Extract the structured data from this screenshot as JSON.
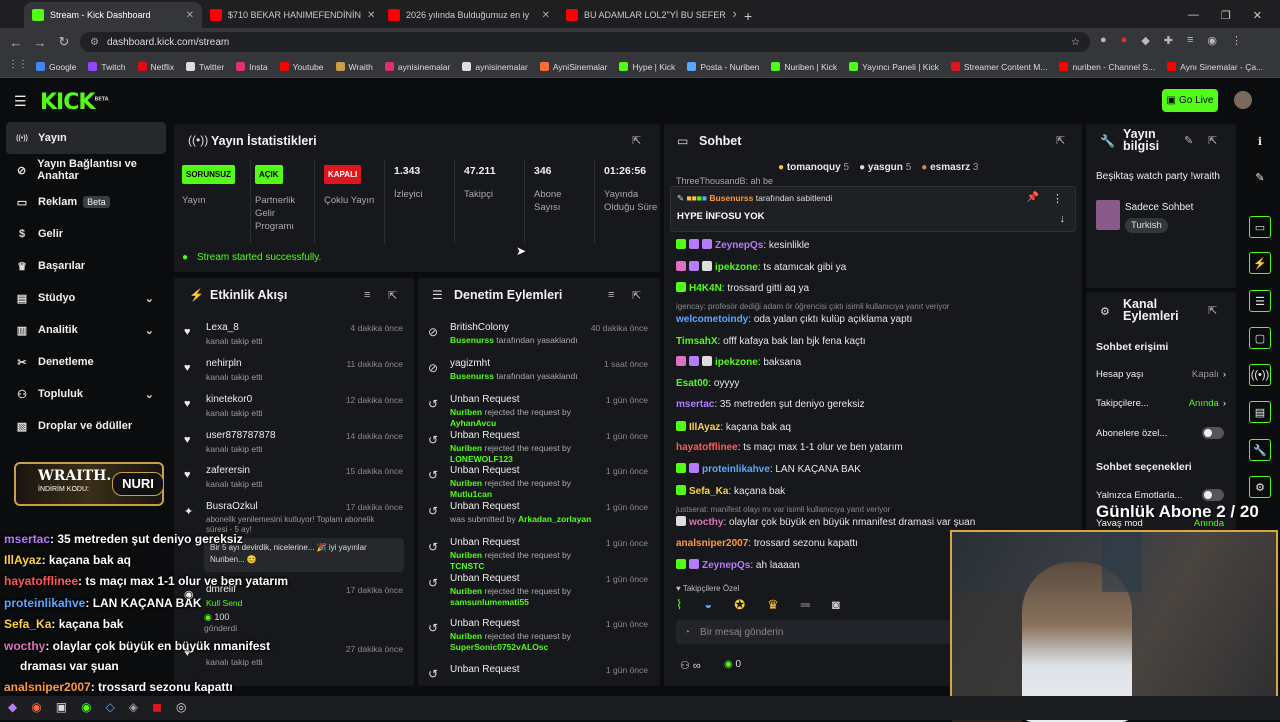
{
  "browser": {
    "tabs": [
      {
        "title": "Stream - Kick Dashboard",
        "color": "#53fc18"
      },
      {
        "title": "$710 BEKAR HANIMEFENDİNİN",
        "color": "#ff0000"
      },
      {
        "title": "2026 yılında Bulduğumuz en iy",
        "color": "#ff0000"
      },
      {
        "title": "BU ADAMLAR LOL2\"Yİ BU SEFER",
        "color": "#ff0000"
      }
    ],
    "url": "dashboard.kick.com/stream",
    "bookmarks": [
      "Google",
      "Twitch",
      "Netflix",
      "Twitter",
      "Insta",
      "Youtube",
      "Wraith",
      "aynisinemalar",
      "aynisinemalar",
      "AyniSinemalar",
      "Hype | Kick",
      "Posta - Nuriben",
      "Nuriben | Kick",
      "Yayıncı Paneli | Kick",
      "Streamer Content M...",
      "nuriben - Channel S...",
      "Aynı Sinemalar - Ça..."
    ]
  },
  "header": {
    "logo": "KICK",
    "beta": "BETA",
    "go_live": "Go Live"
  },
  "sidebar": {
    "items": [
      {
        "label": "Yayın",
        "icon": "broadcast-icon"
      },
      {
        "label": "Yayın Bağlantısı ve Anahtar",
        "icon": "link-icon"
      },
      {
        "label": "Reklam",
        "icon": "ad-icon",
        "badge": "Beta"
      },
      {
        "label": "Gelir",
        "icon": "money-icon"
      },
      {
        "label": "Başarılar",
        "icon": "trophy-icon"
      },
      {
        "label": "Stüdyo",
        "icon": "studio-icon"
      },
      {
        "label": "Analitik",
        "icon": "chart-icon"
      },
      {
        "label": "Denetleme",
        "icon": "moderation-icon"
      },
      {
        "label": "Topluluk",
        "icon": "community-icon"
      },
      {
        "label": "Droplar ve ödüller",
        "icon": "gift-icon"
      }
    ]
  },
  "stats": {
    "title": "Yayın İstatistikleri",
    "badges": [
      "SORUNSUZ",
      "AÇIK",
      "KAPALI"
    ],
    "labels": [
      "Yayın",
      "Partnerlik Gelir Programı",
      "Çoklu Yayın"
    ],
    "viewers": {
      "value": "1.343",
      "label": "İzleyici"
    },
    "followers": {
      "value": "47.211",
      "label": "Takipçi"
    },
    "subs": {
      "value": "346",
      "label": "Abone Sayısı"
    },
    "uptime": {
      "value": "01:26:56",
      "label": "Yayında Olduğu Süre"
    },
    "success": "Stream started successfully."
  },
  "activity": {
    "title": "Etkinlik Akışı",
    "items": [
      {
        "name": "Lexa_8",
        "sub": "kanalı takip etti",
        "time": "4 dakika önce"
      },
      {
        "name": "nehirpln",
        "sub": "kanalı takip etti",
        "time": "11 dakika önce"
      },
      {
        "name": "kinetekor0",
        "sub": "kanalı takip etti",
        "time": "12 dakika önce"
      },
      {
        "name": "user878787878",
        "sub": "kanalı takip etti",
        "time": "14 dakika önce"
      },
      {
        "name": "zaferersin",
        "sub": "kanalı takip etti",
        "time": "15 dakika önce"
      },
      {
        "name": "BusraOzkul",
        "sub": "abonelik yenilemesini kutluyor! Toplam abonelik süresi - 5 ay!",
        "time": "17 dakika önce"
      },
      {
        "name": "dmrelif",
        "sub": "Kull Send",
        "time": "17 dakika önce"
      },
      {
        "name": "",
        "sub": "kanalı takip etti",
        "time": "27 dakika önce"
      }
    ],
    "sub_msg": "Bir 5 ayı devirdik, nicelerine... 🎉 iyi yayınlar Nuriben... 😊",
    "kicks": "100",
    "kicks_label": "gönderdi"
  },
  "moderation": {
    "title": "Denetim Eylemleri",
    "items": [
      {
        "name": "BritishColony",
        "actor": "Busenurss",
        "rest": " tarafından yasaklandı",
        "time": "40 dakika önce",
        "type": "ban"
      },
      {
        "name": "yagizmht",
        "actor": "Busenurss",
        "rest": " tarafından yasaklandı",
        "time": "1 saat önce",
        "type": "ban"
      },
      {
        "name": "Unban Request",
        "actor": "Nuriben",
        "rest": " rejected the request by ",
        "target": "AyhanAvcu",
        "time": "1 gün önce",
        "type": "unban"
      },
      {
        "name": "Unban Request",
        "actor": "Nuriben",
        "rest": " rejected the request by ",
        "target": "LONEWOLF123",
        "time": "1 gün önce",
        "type": "unban"
      },
      {
        "name": "Unban Request",
        "actor": "Nuriben",
        "rest": " rejected the request by ",
        "target": "Mutlu1can",
        "time": "1 gün önce",
        "type": "unban"
      },
      {
        "name": "Unban Request",
        "actor": "",
        "rest": "was submitted by ",
        "target": "Arkadan_zorlayan",
        "time": "1 gün önce",
        "type": "unban"
      },
      {
        "name": "Unban Request",
        "actor": "Nuriben",
        "rest": " rejected the request by ",
        "target": "TCNSTC",
        "time": "1 gün önce",
        "type": "unban"
      },
      {
        "name": "Unban Request",
        "actor": "Nuriben",
        "rest": " rejected the request by ",
        "target": "samsunlumemati55",
        "time": "1 gün önce",
        "type": "unban"
      },
      {
        "name": "Unban Request",
        "actor": "Nuriben",
        "rest": " rejected the request by ",
        "target": "SuperSonic0752vALOsc",
        "time": "1 gün önce",
        "type": "unban"
      },
      {
        "name": "Unban Request",
        "actor": "",
        "rest": "",
        "target": "",
        "time": "1 gün önce",
        "type": "unban"
      }
    ]
  },
  "chat": {
    "title": "Sohbet",
    "top": [
      {
        "name": "tomanoquy",
        "n": "5"
      },
      {
        "name": "yasgun",
        "n": "5"
      },
      {
        "name": "esmasrz",
        "n": "3"
      }
    ],
    "pinned_by": "Busenurss",
    "pinned_by_text": "tarafından sabitlendi",
    "pinned_msg": "HYPE İNFOSU YOK",
    "cut_name": "ThreeThousandB: ah be",
    "lines": [
      {
        "user": "ZeynepQs",
        "color": "#b57cff",
        "msg": "kesinlikle",
        "badges": [
          "#53fc18",
          "#b57cff",
          "#b57cff"
        ]
      },
      {
        "user": "ipekzone",
        "color": "#53fc18",
        "msg": "ts atamıcak gibi ya",
        "badges": [
          "#e070c0",
          "#b57cff",
          "#ddd"
        ]
      },
      {
        "user": "H4K4N",
        "color": "#53fc18",
        "msg": "trossard gitti aq ya",
        "badges": [
          "#53fc18"
        ]
      },
      {
        "user": "welcometoindy",
        "color": "#5aa8ff",
        "msg": "oda yalan çıktı kulüp açıklama yaptı",
        "badges": []
      },
      {
        "user": "TimsahX",
        "color": "#53fc18",
        "msg": "offf kafaya bak lan bjk fena kaçtı",
        "badges": []
      },
      {
        "user": "ipekzone",
        "color": "#53fc18",
        "msg": "baksana",
        "badges": [
          "#e070c0",
          "#b57cff",
          "#ddd"
        ]
      },
      {
        "user": "Esat00",
        "color": "#53fc18",
        "msg": "oyyyy",
        "badges": []
      },
      {
        "user": "msertac",
        "color": "#b57cff",
        "msg": "35 metreden şut deniyo gereksiz",
        "badges": []
      },
      {
        "user": "IllAyaz",
        "color": "#ffd23f",
        "msg": "kaçana bak aq",
        "badges": [
          "#53fc18"
        ]
      },
      {
        "user": "hayatofflinee",
        "color": "#ff5a5a",
        "msg": "ts maçı max 1-1 olur ve ben yatarım",
        "badges": []
      },
      {
        "user": "proteinlikahve",
        "color": "#5aa8ff",
        "msg": "LAN KAÇANA BAK",
        "badges": [
          "#53fc18",
          "#b57cff"
        ]
      },
      {
        "user": "Sefa_Ka",
        "color": "#ffd23f",
        "msg": "kaçana bak",
        "badges": [
          "#53fc18"
        ]
      },
      {
        "user": "wocthy",
        "color": "#e070c0",
        "msg": "olaylar çok büyük en büyük nmanifest dramasi var şuan",
        "badges": [
          "#ddd"
        ]
      },
      {
        "user": "analsniper2007",
        "color": "#ff9a3c",
        "msg": "trossard sezonu kapattı",
        "badges": []
      },
      {
        "user": "ZeynepQs",
        "color": "#b57cff",
        "msg": "ah laaaan",
        "badges": [
          "#53fc18",
          "#b57cff"
        ]
      }
    ],
    "reply1": "igencay: profesör dediği adam ör öğrencisi çıktı isimli kullanıcıya yanıt veriyor",
    "reply2": "justserat: manifest olayı mı var isimli kullanıcıya yanıt veriyor",
    "follower_emotes": "Takipçilere Özel",
    "input_placeholder": "Bir mesaj gönderin",
    "points": "0"
  },
  "stream_info": {
    "title": "Yayın bilgisi",
    "stream_title": "Beşiktaş watch party !wraith",
    "category": "Sadece Sohbet",
    "language": "Turkish"
  },
  "channel_actions": {
    "title": "Kanal Eylemleri",
    "chat_access": "Sohbet erişimi",
    "account_age": {
      "label": "Hesap yaşı",
      "value": "Kapalı"
    },
    "followers": {
      "label": "Takipçilere...",
      "value": "Anında"
    },
    "subs_only": {
      "label": "Abonelere özel..."
    },
    "chat_options": "Sohbet seçenekleri",
    "emotes_only": {
      "label": "Yalnızca Emotlarla..."
    },
    "slow_mode": {
      "label": "Yavaş mod",
      "value": "Anında"
    }
  },
  "overlay": {
    "sub_goal": "Günlük Abone 2 / 20",
    "wraith_name": "WRAITH.",
    "wraith_code_label": "İNDİRİM KODU:",
    "wraith_code": "NURI",
    "lines": [
      {
        "user": "msertac",
        "color": "#b57cff",
        "msg": ": 35 metreden şut deniyo gereksiz"
      },
      {
        "user": "IllAyaz",
        "color": "#ffd23f",
        "msg": ": kaçana bak aq"
      },
      {
        "user": "hayatofflinee",
        "color": "#ff5a5a",
        "msg": ": ts maçı max 1-1 olur ve ben yatarım"
      },
      {
        "user": "proteinlikahve",
        "color": "#5aa8ff",
        "msg": ": LAN KAÇANA BAK"
      },
      {
        "user": "Sefa_Ka",
        "color": "#ffd23f",
        "msg": ": kaçana bak"
      },
      {
        "user": "wocthy",
        "color": "#e070c0",
        "msg": ": olaylar çok büyük en büyük nmanifest"
      },
      {
        "user": "",
        "color": "#fff",
        "msg": "draması var şuan"
      },
      {
        "user": "analsniper2007",
        "color": "#ff9a3c",
        "msg": ": trossard sezonu kapattı"
      },
      {
        "user": "ZeynepQs",
        "color": "#b57cff",
        "msg": ": ah laaaan"
      }
    ]
  }
}
